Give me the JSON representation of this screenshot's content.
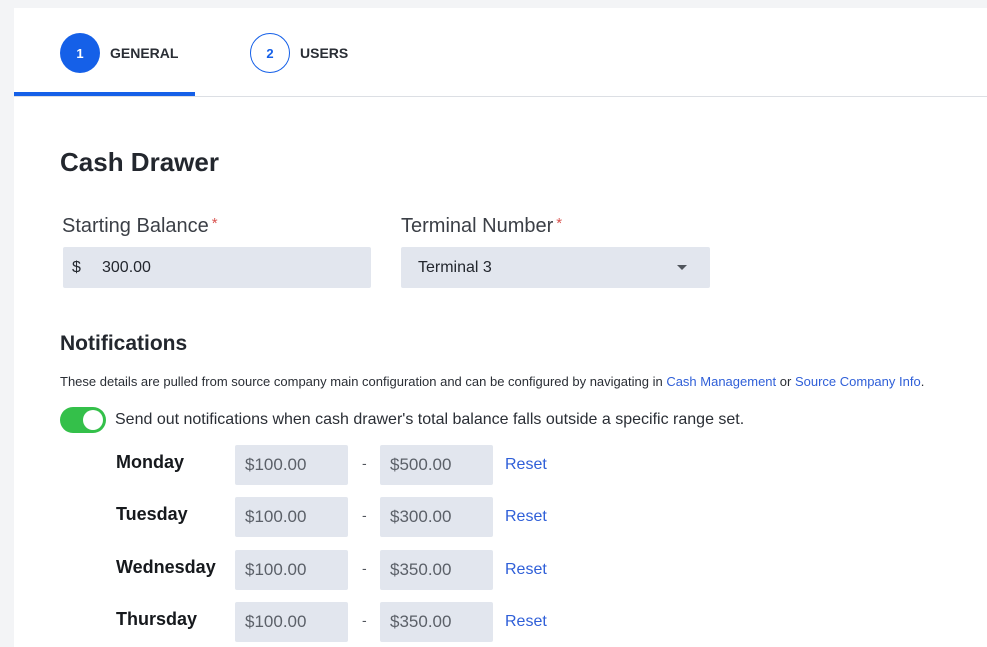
{
  "tabs": [
    {
      "number": "1",
      "label": "GENERAL"
    },
    {
      "number": "2",
      "label": "USERS"
    }
  ],
  "cash_drawer": {
    "title": "Cash Drawer",
    "starting_balance": {
      "label": "Starting Balance",
      "required_mark": "*",
      "currency": "$",
      "value": "300.00"
    },
    "terminal_number": {
      "label": "Terminal Number",
      "required_mark": "*",
      "value": "Terminal 3"
    }
  },
  "notifications": {
    "title": "Notifications",
    "info_prefix": "These details are pulled from source company main configuration and can be configured by navigating in ",
    "link1": "Cash Management",
    "info_mid": " or ",
    "link2": "Source Company Info",
    "info_suffix": ".",
    "toggle_on": true,
    "toggle_label": "Send out notifications when cash drawer's total balance falls outside a specific range set.",
    "dash": "-",
    "reset_label": "Reset",
    "rows": [
      {
        "day": "Monday",
        "min": "$100.00",
        "max": "$500.00"
      },
      {
        "day": "Tuesday",
        "min": "$100.00",
        "max": "$300.00"
      },
      {
        "day": "Wednesday",
        "min": "$100.00",
        "max": "$350.00"
      },
      {
        "day": "Thursday",
        "min": "$100.00",
        "max": "$350.00"
      }
    ]
  },
  "colors": {
    "accent": "#1560e8",
    "toggle_on": "#34c04a",
    "link": "#2f5fd8",
    "input_bg": "#e2e6ee"
  }
}
